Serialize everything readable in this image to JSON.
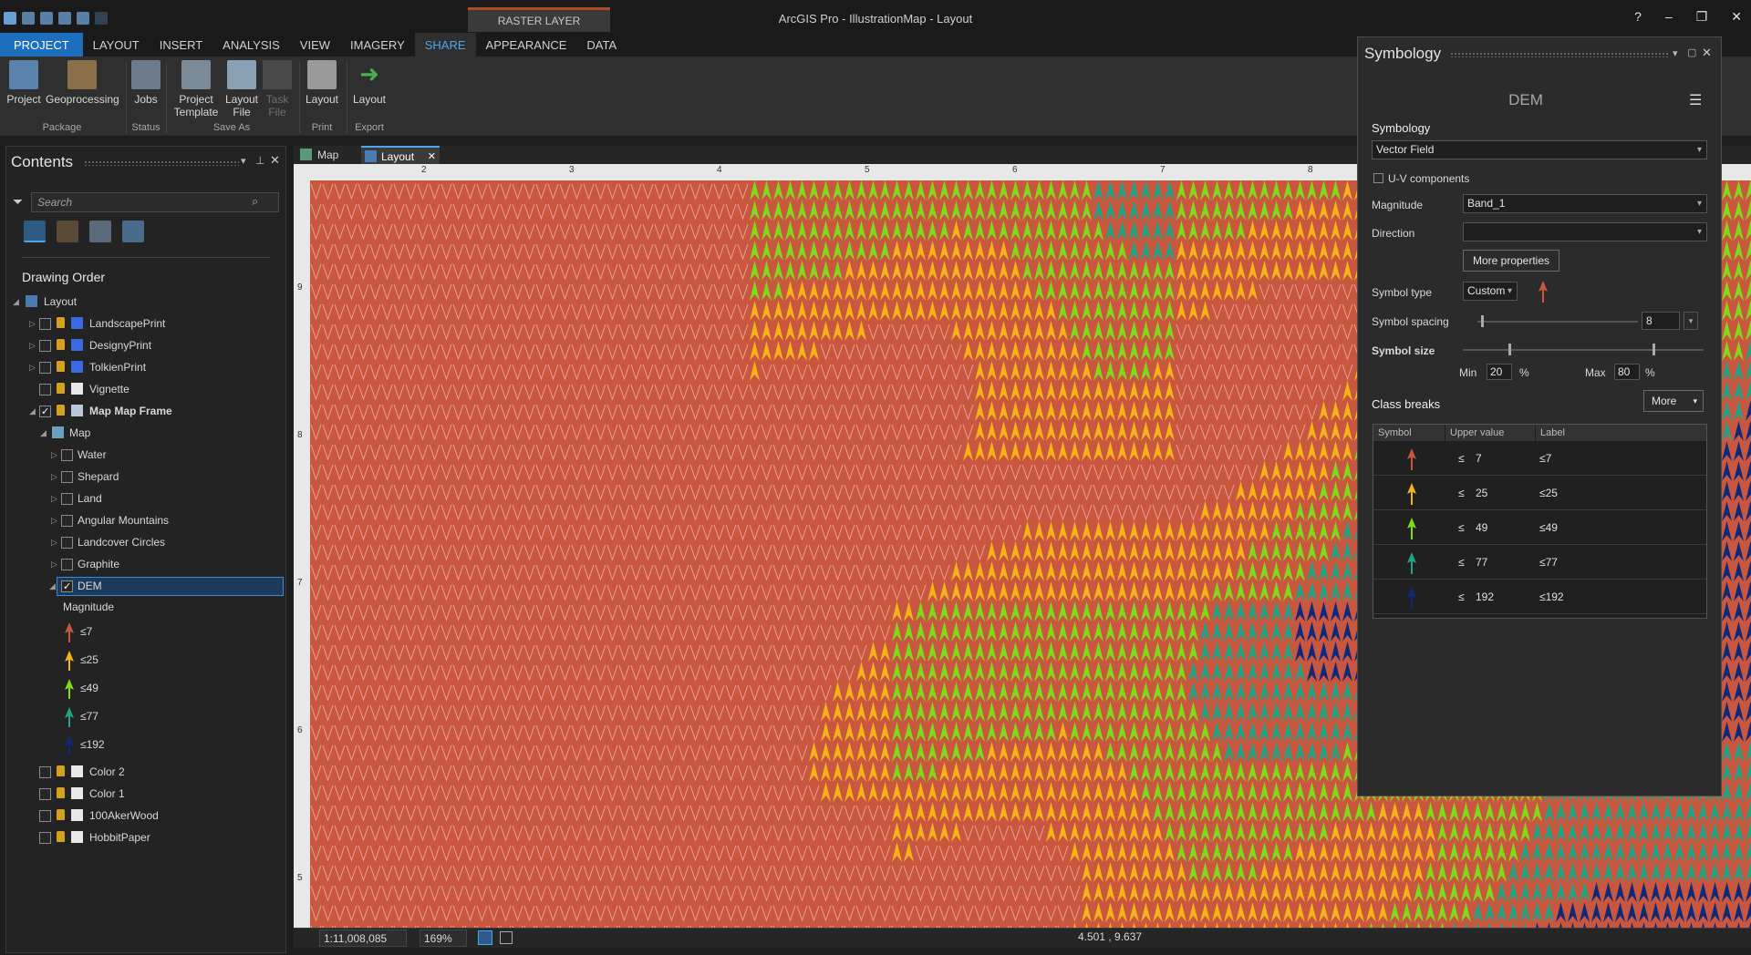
{
  "window": {
    "title": "ArcGIS Pro - IllustrationMap - Layout",
    "contextual_tab": "RASTER LAYER",
    "help": "?",
    "minimize": "–",
    "restore": "❐",
    "close": "✕"
  },
  "ribbon_tabs": [
    "PROJECT",
    "LAYOUT",
    "INSERT",
    "ANALYSIS",
    "VIEW",
    "IMAGERY",
    "SHARE",
    "APPEARANCE",
    "DATA"
  ],
  "ribbon": {
    "buttons": [
      {
        "label": "Project",
        "group": "Package"
      },
      {
        "label": "Geoprocessing",
        "group": "Package"
      },
      {
        "label": "Jobs",
        "group": "Status"
      },
      {
        "label": "Project Template",
        "group": "Save As"
      },
      {
        "label": "Layout File",
        "group": "Save As"
      },
      {
        "label": "Task File",
        "group": "Save As"
      },
      {
        "label": "Layout",
        "group": "Print"
      },
      {
        "label": "Layout",
        "group": "Export"
      }
    ],
    "groups": [
      "Package",
      "Status",
      "Save As",
      "Print",
      "Export"
    ]
  },
  "contents": {
    "title": "Contents",
    "search_placeholder": "Search",
    "drawing_order": "Drawing Order",
    "root": "Layout",
    "items": [
      {
        "label": "LandscapePrint"
      },
      {
        "label": "DesignyPrint"
      },
      {
        "label": "TolkienPrint"
      },
      {
        "label": "Vignette"
      },
      {
        "label": "Map Map Frame"
      },
      {
        "label": "Map"
      },
      {
        "label": "Water"
      },
      {
        "label": "Shepard"
      },
      {
        "label": "Land"
      },
      {
        "label": "Angular Mountains"
      },
      {
        "label": "Landcover Circles"
      },
      {
        "label": "Graphite"
      },
      {
        "label": "DEM"
      },
      {
        "label": "Magnitude"
      },
      {
        "label": "Color 2"
      },
      {
        "label": "Color 1"
      },
      {
        "label": "100AkerWood"
      },
      {
        "label": "HobbitPaper"
      }
    ],
    "legend": [
      {
        "label": "≤7",
        "color": "#c95740"
      },
      {
        "label": "≤25",
        "color": "#f5b318"
      },
      {
        "label": "≤49",
        "color": "#7fdb1a"
      },
      {
        "label": "≤77",
        "color": "#1fa585"
      },
      {
        "label": "≤192",
        "color": "#0d2a7a"
      }
    ]
  },
  "doc_tabs": [
    {
      "label": "Map"
    },
    {
      "label": "Layout"
    }
  ],
  "ruler": {
    "top": [
      "2",
      "3",
      "4",
      "5",
      "6",
      "7",
      "8"
    ],
    "left": [
      "9",
      "8",
      "7",
      "6",
      "5"
    ]
  },
  "status": {
    "scale": "1:11,008,085",
    "zoom": "169%",
    "coords": "4.501 , 9.637"
  },
  "symbology": {
    "title": "Symbology",
    "layer": "DEM",
    "section": "Symbology",
    "renderer": "Vector Field",
    "uv_components": "U-V components",
    "magnitude_label": "Magnitude",
    "magnitude_value": "Band_1",
    "direction_label": "Direction",
    "direction_value": "",
    "more_properties": "More properties",
    "symbol_type_label": "Symbol type",
    "symbol_type_value": "Custom",
    "symbol_spacing_label": "Symbol spacing",
    "symbol_spacing_value": "8",
    "symbol_spacing_level": 0.02,
    "symbol_size_label": "Symbol size",
    "min_label": "Min",
    "min_value": "20",
    "max_label": "Max",
    "max_value": "80",
    "percent": "%",
    "class_breaks": "Class breaks",
    "more": "More",
    "columns": [
      "Symbol",
      "Upper value",
      "Label"
    ],
    "rows": [
      {
        "op": "≤",
        "value": "7",
        "label": "≤7",
        "color": "#c95740"
      },
      {
        "op": "≤",
        "value": "25",
        "label": "≤25",
        "color": "#f5b318"
      },
      {
        "op": "≤",
        "value": "49",
        "label": "≤49",
        "color": "#7fdb1a"
      },
      {
        "op": "≤",
        "value": "77",
        "label": "≤77",
        "color": "#1fa585"
      },
      {
        "op": "≤",
        "value": "192",
        "label": "≤192",
        "color": "#0d2a7a"
      }
    ]
  }
}
